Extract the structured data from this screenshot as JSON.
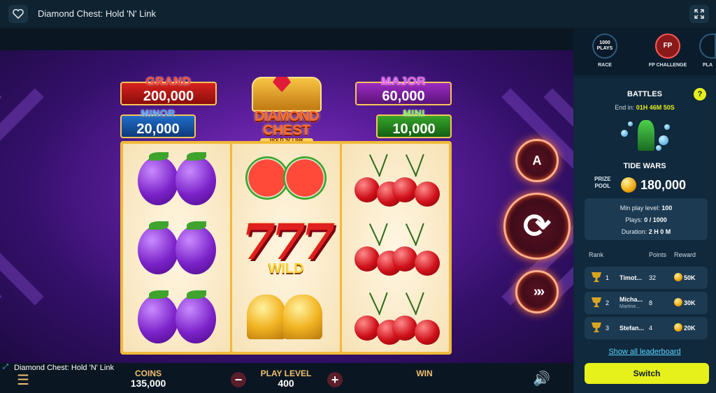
{
  "window": {
    "title": "Diamond Chest: Hold 'N' Link"
  },
  "icons": {
    "favorite": "heart-icon",
    "expand": "expand-icon"
  },
  "jackpots": {
    "grand": {
      "name": "GRAND",
      "value": "200,000"
    },
    "major": {
      "name": "MAJOR",
      "value": "60,000"
    },
    "minor": {
      "name": "MINOR",
      "value": "20,000"
    },
    "mini": {
      "name": "MINI",
      "value": "10,000"
    }
  },
  "logo": {
    "line1": "DIAMOND",
    "line2": "CHEST",
    "sub": "HOLD 'N' LINK"
  },
  "reels": [
    [
      "plum",
      "plum",
      "plum"
    ],
    [
      "watermelon",
      "wild-777",
      "bell"
    ],
    [
      "cherry",
      "cherry",
      "cherry"
    ]
  ],
  "wild_label": "WILD",
  "wild_glyph": "777",
  "controls": {
    "auto_glyph": "A",
    "spin_glyph": "⟳",
    "fast_glyph": "»»"
  },
  "bottom": {
    "coins_label": "COINS",
    "coins_value": "135,000",
    "minus": "−",
    "plus": "+",
    "play_level_label": "PLAY LEVEL",
    "play_level_value": "400",
    "win_label": "WIN",
    "menu_glyph": "☰",
    "sound_glyph": "🔊",
    "frame_label": "Diamond Chest: Hold 'N' Link"
  },
  "sidebar": {
    "tabs": [
      {
        "badge": "1000 PLAYS",
        "label": "RACE"
      },
      {
        "badge": "FP",
        "label": "FP CHALLENGE"
      },
      {
        "badge": "",
        "label": "PLA"
      }
    ],
    "battles_title": "BATTLES",
    "help": "?",
    "end_in_label": "End in:",
    "end_in_value": "01H 46M 50S",
    "event_name": "TIDE WARS",
    "prize_label_1": "PRIZE",
    "prize_label_2": "POOL",
    "prize_value": "180,000",
    "info": {
      "min_play_label": "Min play level:",
      "min_play_value": "100",
      "plays_label": "Plays:",
      "plays_value": "0 / 1000",
      "duration_label": "Duration:",
      "duration_value": "2 H 0 M"
    },
    "headers": {
      "rank": "Rank",
      "points": "Points",
      "reward": "Reward"
    },
    "leaderboard": [
      {
        "rank": "1",
        "name": "Timot...",
        "sub": "",
        "points": "32",
        "reward": "50K"
      },
      {
        "rank": "2",
        "name": "Micha...",
        "sub": "Martine...",
        "points": "8",
        "reward": "30K"
      },
      {
        "rank": "3",
        "name": "Stefan...",
        "sub": "",
        "points": "4",
        "reward": "20K"
      }
    ],
    "show_all": "Show all leaderboard",
    "switch": "Switch"
  }
}
